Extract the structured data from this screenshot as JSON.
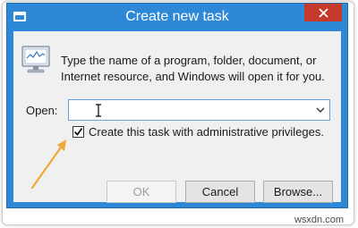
{
  "window": {
    "title": "Create new task",
    "close_label": "×"
  },
  "dialog": {
    "description": "Type the name of a program, folder, document, or Internet resource, and Windows will open it for you.",
    "open_label": "Open:",
    "open_value": "",
    "admin_checkbox_label": "Create this task with administrative privileges.",
    "admin_checked": true
  },
  "buttons": {
    "ok": "OK",
    "cancel": "Cancel",
    "browse": "Browse..."
  },
  "watermark": "wsxdn.com",
  "colors": {
    "titlebar": "#2d89d8",
    "close_button": "#c7392a",
    "dialog_background": "#f0f0f0",
    "callout_arrow": "#f0a832"
  },
  "icons": [
    "app-icon",
    "close-icon",
    "monitor-icon",
    "text-cursor-icon",
    "chevron-down-icon",
    "checkmark-icon",
    "callout-arrow-icon"
  ]
}
